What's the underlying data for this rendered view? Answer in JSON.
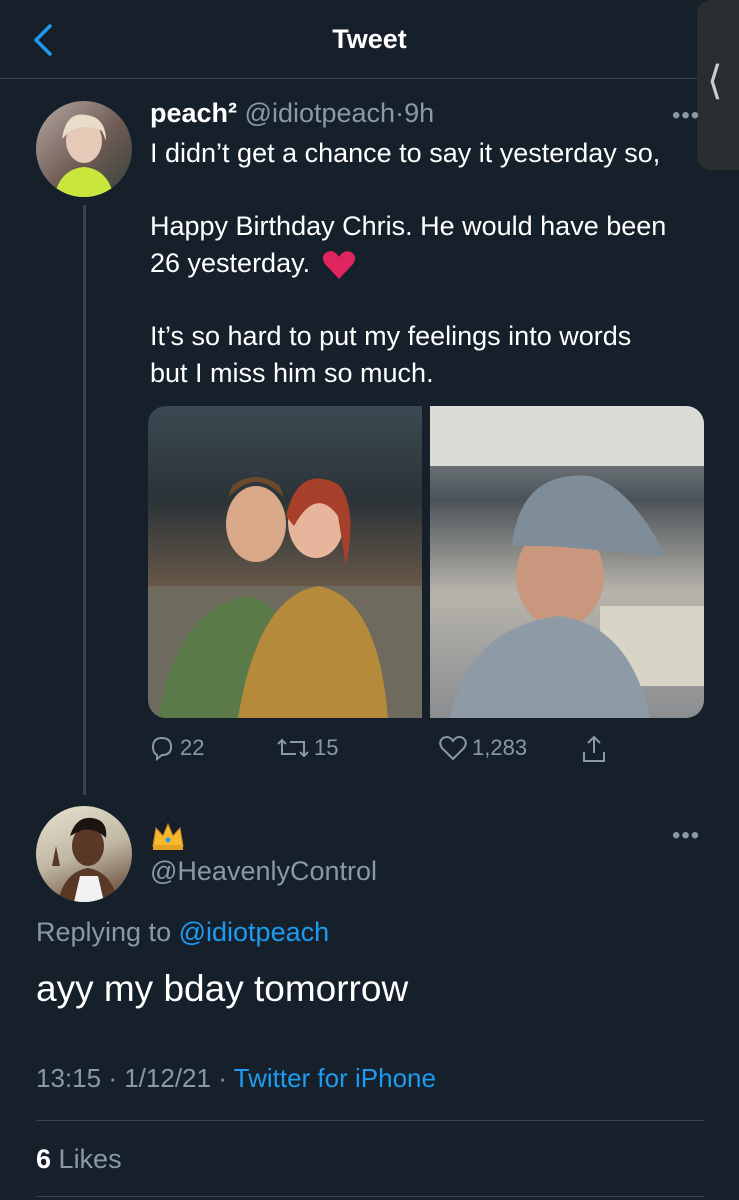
{
  "header": {
    "title": "Tweet"
  },
  "tweet": {
    "display_name": "peach²",
    "handle": "@idiotpeach",
    "separator": "·",
    "time": "9h",
    "line1": "I didn’t get a chance to say it yesterday so,",
    "line2": "Happy Birthday Chris. He would have been",
    "line3": "26 yesterday.",
    "line4": "It’s so hard to put my feelings into words",
    "line5": "but I miss him so much.",
    "actions": {
      "replies": "22",
      "retweets": "15",
      "likes": "1,283"
    }
  },
  "reply": {
    "display_name_icon": "crown-emoji",
    "handle": "@HeavenlyControl",
    "replying_prefix": "Replying to",
    "replying_to": "@idiotpeach",
    "text": "ayy my bday tomorrow",
    "time": "13:15",
    "date": "1/12/21",
    "sep": "·",
    "client": "Twitter for iPhone",
    "likes_count": "6",
    "likes_label": "Likes"
  },
  "colors": {
    "background": "#15202b",
    "accent": "#1d9bf0",
    "secondary_text": "#8b98a5",
    "heart": "#e0245e"
  }
}
